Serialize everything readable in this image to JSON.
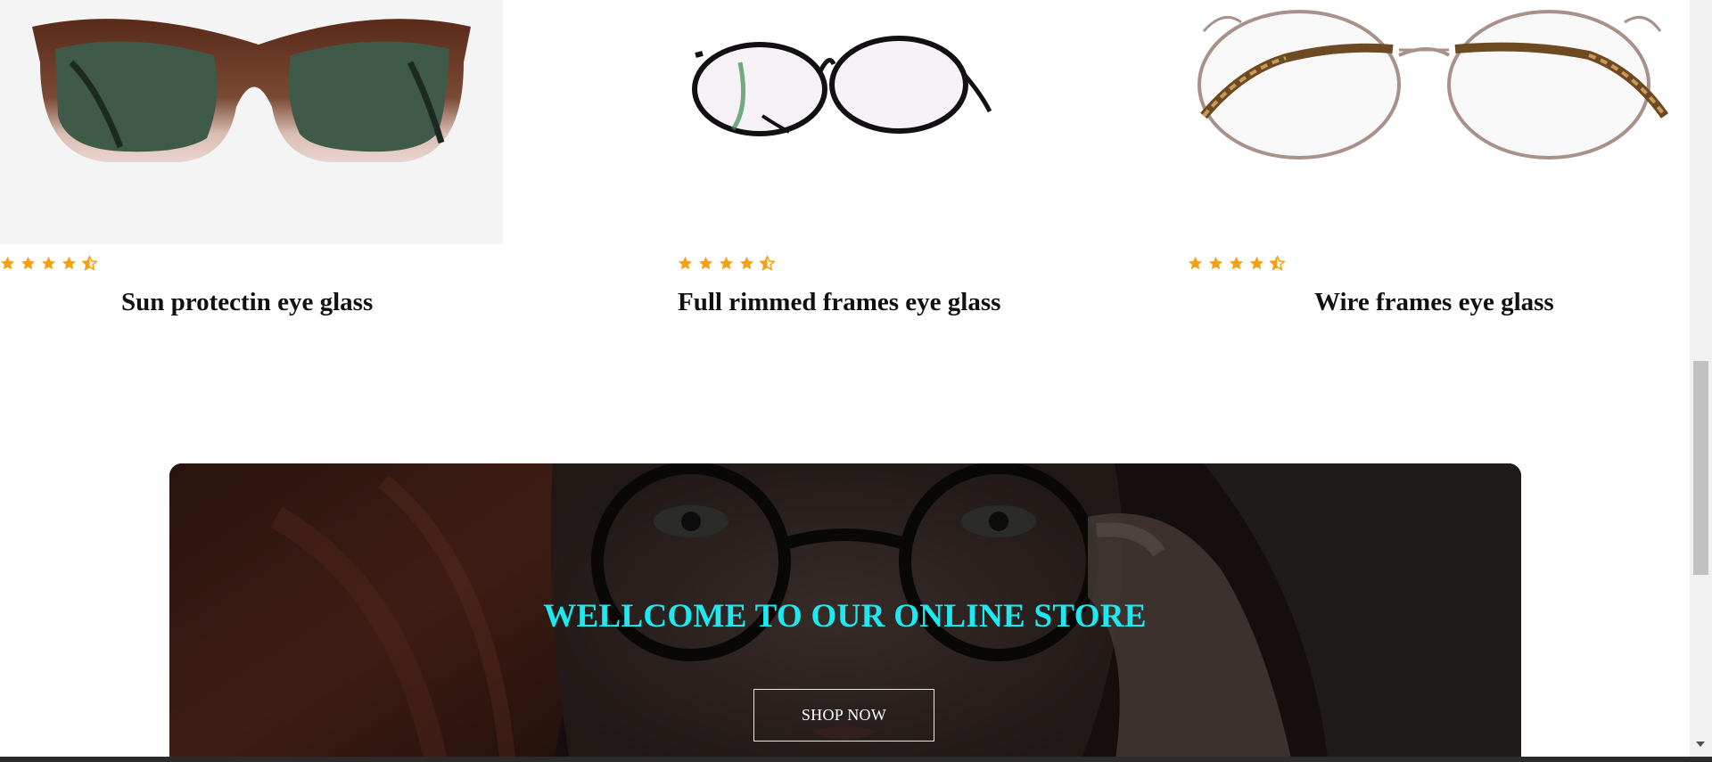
{
  "products": [
    {
      "title": "Sun protectin eye glass",
      "rating": 4.5,
      "image_icon": "sunglasses-icon"
    },
    {
      "title": "Full rimmed frames eye glass",
      "rating": 4.5,
      "image_icon": "black-frame-glasses-icon"
    },
    {
      "title": "Wire frames eye glass",
      "rating": 4.5,
      "image_icon": "wire-frame-glasses-icon"
    }
  ],
  "hero": {
    "title": "WELLCOME TO OUR ONLINE STORE",
    "button_label": "SHOP NOW"
  },
  "colors": {
    "star": "#f5a00f",
    "hero_title": "#1de9f0",
    "hero_overlay": "#1b1513"
  }
}
